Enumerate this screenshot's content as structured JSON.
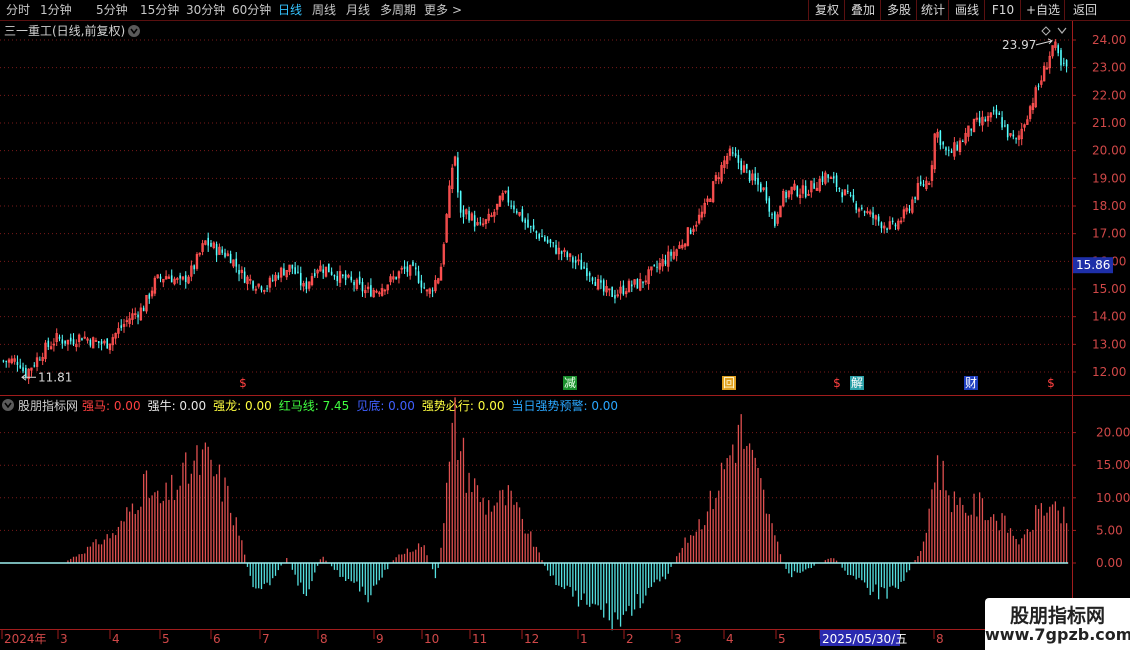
{
  "toolbar": {
    "periods": [
      "分时",
      "1分钟",
      "5分钟",
      "15分钟",
      "30分钟",
      "60分钟",
      "日线",
      "周线",
      "月线",
      "多周期",
      "更多"
    ],
    "active_period": "日线",
    "more_arrow": ">",
    "right_buttons": [
      "复权",
      "叠加",
      "多股",
      "统计",
      "画线",
      "F10",
      "+自选",
      "返回"
    ]
  },
  "main_panel": {
    "title": "三一重工(日线,前复权)",
    "price_ticks": [
      "24.00",
      "23.00",
      "22.00",
      "21.00",
      "20.00",
      "19.00",
      "18.00",
      "17.00",
      "16.00",
      "15.00",
      "14.00",
      "13.00",
      "12.00"
    ],
    "current_price": "15.86",
    "high_label": "23.97",
    "low_label": "11.81",
    "events": [
      {
        "text": "$",
        "kind": "dollar"
      },
      {
        "text": "减",
        "kind": "green"
      },
      {
        "text": "回",
        "kind": "yellow"
      },
      {
        "text": "$",
        "kind": "dollar"
      },
      {
        "text": "解",
        "kind": "cyan"
      },
      {
        "text": "财",
        "kind": "blue"
      },
      {
        "text": "$",
        "kind": "dollar"
      }
    ]
  },
  "indicator_panel": {
    "name": "股朋指标网",
    "legend": [
      {
        "label": "强马",
        "value": "0.00",
        "color": "#ff4040"
      },
      {
        "label": "强牛",
        "value": "0.00",
        "color": "#e8e8e8"
      },
      {
        "label": "强龙",
        "value": "0.00",
        "color": "#ffff40"
      },
      {
        "label": "红马线",
        "value": "7.45",
        "color": "#40ff40"
      },
      {
        "label": "见底",
        "value": "0.00",
        "color": "#4060ff"
      },
      {
        "label": "强势必行",
        "value": "0.00",
        "color": "#ffff40"
      },
      {
        "label": "当日强势预警",
        "value": "0.00",
        "color": "#2aa7ff"
      }
    ],
    "value_ticks": [
      "20.00",
      "15.00",
      "10.00",
      "5.00",
      "0.00"
    ]
  },
  "date_axis": {
    "labels": [
      "2024年",
      "3",
      "4",
      "5",
      "6",
      "7",
      "8",
      "9",
      "10",
      "11",
      "12",
      "1",
      "2",
      "3",
      "4",
      "5",
      "2025/05/30/五",
      "8"
    ]
  },
  "watermark": {
    "title": "股朋指标网",
    "url": "www.7gpzb.com"
  },
  "colors": {
    "up": "#ff5050",
    "down": "#54ffff",
    "grid": "#7a1a1a",
    "axis": "#a01c1c",
    "text": "#c0c0c0",
    "indicator_pos": "#e05050",
    "indicator_neg": "#54e0e0"
  },
  "chart_data": [
    {
      "type": "candlestick",
      "title": "三一重工(日线,前复权)",
      "ylim": [
        11.6,
        24.3
      ],
      "x_range": [
        "2024-02",
        "2025-07"
      ],
      "close_path": [
        {
          "x": "2024-02-05",
          "y": 12.4
        },
        {
          "x": "2024-02-08",
          "y": 11.9
        },
        {
          "x": "2024-02-19",
          "y": 12.8
        },
        {
          "x": "2024-02-26",
          "y": 13.2
        },
        {
          "x": "2024-03-04",
          "y": 13.1
        },
        {
          "x": "2024-03-11",
          "y": 13.3
        },
        {
          "x": "2024-03-18",
          "y": 13.1
        },
        {
          "x": "2024-03-25",
          "y": 13.0
        },
        {
          "x": "2024-04-01",
          "y": 13.5
        },
        {
          "x": "2024-04-08",
          "y": 14.0
        },
        {
          "x": "2024-04-15",
          "y": 14.3
        },
        {
          "x": "2024-04-22",
          "y": 15.3
        },
        {
          "x": "2024-04-29",
          "y": 15.5
        },
        {
          "x": "2024-05-06",
          "y": 15.2
        },
        {
          "x": "2024-05-13",
          "y": 15.7
        },
        {
          "x": "2024-05-20",
          "y": 16.7
        },
        {
          "x": "2024-05-27",
          "y": 16.4
        },
        {
          "x": "2024-06-03",
          "y": 16.2
        },
        {
          "x": "2024-06-10",
          "y": 15.5
        },
        {
          "x": "2024-06-17",
          "y": 15.2
        },
        {
          "x": "2024-06-24",
          "y": 15.1
        },
        {
          "x": "2024-07-01",
          "y": 15.6
        },
        {
          "x": "2024-07-08",
          "y": 15.8
        },
        {
          "x": "2024-07-15",
          "y": 15.0
        },
        {
          "x": "2024-07-22",
          "y": 15.8
        },
        {
          "x": "2024-07-29",
          "y": 15.7
        },
        {
          "x": "2024-08-05",
          "y": 15.4
        },
        {
          "x": "2024-08-12",
          "y": 15.2
        },
        {
          "x": "2024-08-19",
          "y": 14.9
        },
        {
          "x": "2024-08-26",
          "y": 15.0
        },
        {
          "x": "2024-09-02",
          "y": 15.3
        },
        {
          "x": "2024-09-09",
          "y": 15.7
        },
        {
          "x": "2024-09-16",
          "y": 15.6
        },
        {
          "x": "2024-09-23",
          "y": 14.8
        },
        {
          "x": "2024-09-30",
          "y": 15.6
        },
        {
          "x": "2024-10-08",
          "y": 20.1
        },
        {
          "x": "2024-10-11",
          "y": 17.6
        },
        {
          "x": "2024-10-15",
          "y": 17.8
        },
        {
          "x": "2024-10-22",
          "y": 17.2
        },
        {
          "x": "2024-10-29",
          "y": 17.6
        },
        {
          "x": "2024-11-05",
          "y": 18.4
        },
        {
          "x": "2024-11-12",
          "y": 17.9
        },
        {
          "x": "2024-11-19",
          "y": 17.2
        },
        {
          "x": "2024-11-26",
          "y": 16.9
        },
        {
          "x": "2024-12-03",
          "y": 16.5
        },
        {
          "x": "2024-12-10",
          "y": 16.2
        },
        {
          "x": "2024-12-17",
          "y": 15.9
        },
        {
          "x": "2024-12-24",
          "y": 15.6
        },
        {
          "x": "2024-12-31",
          "y": 14.9
        },
        {
          "x": "2025-01-07",
          "y": 14.8
        },
        {
          "x": "2025-01-14",
          "y": 15.1
        },
        {
          "x": "2025-01-21",
          "y": 15.2
        },
        {
          "x": "2025-02-05",
          "y": 16.1
        },
        {
          "x": "2025-02-12",
          "y": 16.5
        },
        {
          "x": "2025-02-19",
          "y": 17.2
        },
        {
          "x": "2025-02-26",
          "y": 17.8
        },
        {
          "x": "2025-03-05",
          "y": 19.0
        },
        {
          "x": "2025-03-12",
          "y": 19.9
        },
        {
          "x": "2025-03-19",
          "y": 19.5
        },
        {
          "x": "2025-03-26",
          "y": 18.9
        },
        {
          "x": "2025-04-02",
          "y": 18.5
        },
        {
          "x": "2025-04-07",
          "y": 17.3
        },
        {
          "x": "2025-04-10",
          "y": 18.2
        },
        {
          "x": "2025-04-17",
          "y": 18.6
        },
        {
          "x": "2025-04-24",
          "y": 18.5
        },
        {
          "x": "2025-05-06",
          "y": 19.1
        },
        {
          "x": "2025-05-13",
          "y": 18.7
        },
        {
          "x": "2025-05-20",
          "y": 18.2
        },
        {
          "x": "2025-05-27",
          "y": 17.9
        },
        {
          "x": "2025-05-30",
          "y": 17.7
        },
        {
          "x": "2025-06-06",
          "y": 17.4
        },
        {
          "x": "2025-06-13",
          "y": 17.2
        },
        {
          "x": "2025-06-20",
          "y": 17.7
        },
        {
          "x": "2025-06-27",
          "y": 18.6
        },
        {
          "x": "2025-07-04",
          "y": 19.0
        },
        {
          "x": "2025-07-07",
          "y": 20.8
        },
        {
          "x": "2025-07-14",
          "y": 19.8
        },
        {
          "x": "2025-07-21",
          "y": 20.3
        },
        {
          "x": "2025-07-28",
          "y": 20.9
        },
        {
          "x": "2025-08-04",
          "y": 21.1
        },
        {
          "x": "2025-08-11",
          "y": 21.3
        },
        {
          "x": "2025-08-18",
          "y": 20.5
        },
        {
          "x": "2025-08-22",
          "y": 20.3
        },
        {
          "x": "2025-08-29",
          "y": 21.5
        },
        {
          "x": "2025-09-05",
          "y": 22.6
        },
        {
          "x": "2025-09-12",
          "y": 23.9
        },
        {
          "x": "2025-09-16",
          "y": 23.0
        }
      ],
      "high": 23.97,
      "low": 11.81,
      "last": 15.86
    },
    {
      "type": "bar",
      "title": "股朋指标网",
      "ylim": [
        -9,
        22
      ],
      "x_range": [
        "2024-02",
        "2025-09"
      ],
      "profile": [
        {
          "x": "2024-02",
          "y": 0
        },
        {
          "x": "2024-03",
          "y": 0
        },
        {
          "x": "2024-04-01",
          "y": 5
        },
        {
          "x": "2024-04-15",
          "y": 12
        },
        {
          "x": "2024-04-25",
          "y": 9
        },
        {
          "x": "2024-05-10",
          "y": 14
        },
        {
          "x": "2024-05-20",
          "y": 16
        },
        {
          "x": "2024-06-01",
          "y": 11
        },
        {
          "x": "2024-06-10",
          "y": 3
        },
        {
          "x": "2024-06-15",
          "y": -3
        },
        {
          "x": "2024-06-25",
          "y": -4
        },
        {
          "x": "2024-07-05",
          "y": 1
        },
        {
          "x": "2024-07-15",
          "y": -5
        },
        {
          "x": "2024-07-25",
          "y": 1
        },
        {
          "x": "2024-08-05",
          "y": -2
        },
        {
          "x": "2024-08-20",
          "y": -5
        },
        {
          "x": "2024-09-05",
          "y": 1
        },
        {
          "x": "2024-09-20",
          "y": 3
        },
        {
          "x": "2024-09-28",
          "y": -3
        },
        {
          "x": "2024-10-08",
          "y": 22
        },
        {
          "x": "2024-10-15",
          "y": 14
        },
        {
          "x": "2024-10-25",
          "y": 9
        },
        {
          "x": "2024-11-08",
          "y": 10
        },
        {
          "x": "2024-11-20",
          "y": 4
        },
        {
          "x": "2024-12-01",
          "y": -2
        },
        {
          "x": "2024-12-15",
          "y": -5
        },
        {
          "x": "2025-01-01",
          "y": -8
        },
        {
          "x": "2025-01-10",
          "y": -9
        },
        {
          "x": "2025-01-20",
          "y": -6
        },
        {
          "x": "2025-02-05",
          "y": -2
        },
        {
          "x": "2025-02-15",
          "y": 3
        },
        {
          "x": "2025-02-28",
          "y": 8
        },
        {
          "x": "2025-03-10",
          "y": 15
        },
        {
          "x": "2025-03-18",
          "y": 21
        },
        {
          "x": "2025-03-30",
          "y": 12
        },
        {
          "x": "2025-04-07",
          "y": 4
        },
        {
          "x": "2025-04-15",
          "y": -2
        },
        {
          "x": "2025-04-25",
          "y": -1
        },
        {
          "x": "2025-05-10",
          "y": 1
        },
        {
          "x": "2025-05-20",
          "y": -2
        },
        {
          "x": "2025-05-30",
          "y": -4
        },
        {
          "x": "2025-06-10",
          "y": -5
        },
        {
          "x": "2025-06-20",
          "y": -2
        },
        {
          "x": "2025-07-01",
          "y": 3
        },
        {
          "x": "2025-07-07",
          "y": 16
        },
        {
          "x": "2025-07-20",
          "y": 8
        },
        {
          "x": "2025-08-01",
          "y": 9
        },
        {
          "x": "2025-08-15",
          "y": 6
        },
        {
          "x": "2025-08-25",
          "y": 3
        },
        {
          "x": "2025-09-05",
          "y": 9
        },
        {
          "x": "2025-09-16",
          "y": 7
        }
      ]
    }
  ]
}
